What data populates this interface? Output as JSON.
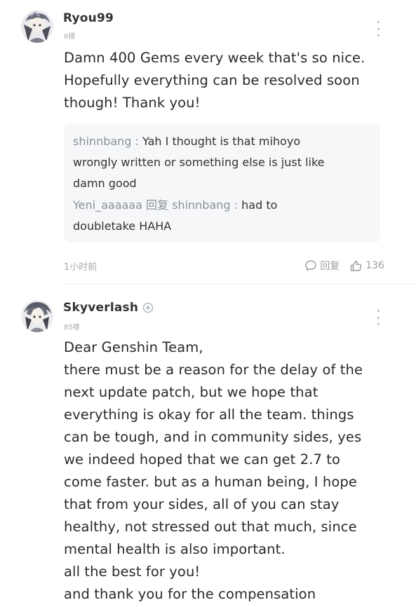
{
  "comments": [
    {
      "username": "Ryou99",
      "floor": "8楼",
      "body_lines": [
        "Damn 400 Gems every week that's so nice.",
        "Hopefully everything can be resolved soon",
        "though! Thank you!"
      ],
      "replies": [
        {
          "author": "shinnbang",
          "separator": " : ",
          "line1": "Yah I thought is that mihoyo",
          "line2": "wrongly written or something else is just like",
          "line3": "damn good"
        },
        {
          "author": "Yeni_aaaaaa",
          "reply_word": " 回复 ",
          "target": "shinnbang",
          "separator": " : ",
          "line1": "had to",
          "line2": "doubletake HAHA"
        }
      ],
      "time": "1小时前",
      "reply_label": "回复",
      "like_count": "136"
    },
    {
      "username": "Skyverlash",
      "floor": "85楼",
      "body_lines": [
        "Dear Genshin Team,",
        "there must be a reason for the delay of the",
        "next update patch, but we hope that",
        "everything is okay for all the team. things",
        "can be tough, and in community sides, yes",
        "we indeed hoped that we can get 2.7 to",
        "come faster. but as a human being, I hope",
        "that from your sides, all of you can stay",
        "healthy, not stressed out that much, since",
        "mental health is also important.",
        "all the best for you!",
        "and thank you for the compensation"
      ]
    }
  ],
  "colors": {
    "reply_box_bg": "#f6f7f9",
    "muted_text": "#a8a8a8",
    "reply_name": "#8a8f99"
  },
  "icons": [
    "more-vertical-icon",
    "comment-bubble-icon",
    "thumbs-up-icon",
    "verified-badge-icon"
  ]
}
